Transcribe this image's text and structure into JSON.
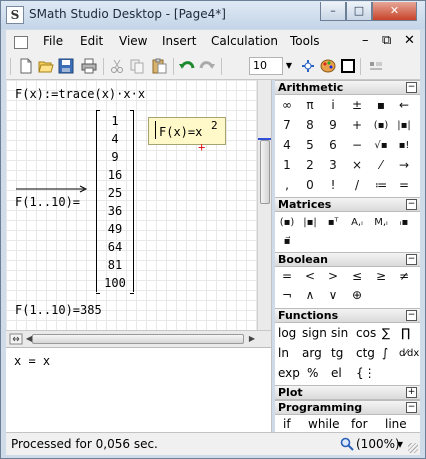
{
  "window": {
    "title": "SMath Studio Desktop - [Page4*]",
    "app_icon_letter": "S",
    "buttons": {
      "minimize": "–",
      "maximize": "□",
      "close": "✕"
    }
  },
  "menubar": {
    "items": [
      "File",
      "Edit",
      "View",
      "Insert",
      "Calculation",
      "Tools"
    ],
    "mdi": {
      "minimize": "–",
      "restore": "⧉",
      "close": "✕"
    }
  },
  "toolbar": {
    "icons": [
      "new-document-icon",
      "open-folder-icon",
      "save-icon",
      "print-icon",
      "cut-icon",
      "copy-icon",
      "paste-icon",
      "undo-icon",
      "redo-icon",
      "zoom-combo",
      "arrow-down-icon",
      "function-icon",
      "palette-icon",
      "square-icon",
      "grid-icon"
    ],
    "zoom_value": "10",
    "zoom_arrow": "▼"
  },
  "worksheet": {
    "line1": "F(x):=trace(x)·x·x",
    "range_expr": "F(1..10)=",
    "matrix_values": [
      "1",
      "4",
      "9",
      "16",
      "25",
      "36",
      "49",
      "64",
      "81",
      "100"
    ],
    "sum_expr": "F(1..10)=385",
    "tooltip": "F(x)=x",
    "tooltip_sup": "2",
    "red_marker": "+"
  },
  "hscroll": {
    "left_arrow": "◀",
    "right_arrow": "▶"
  },
  "console": {
    "text": "x = x"
  },
  "panel": {
    "arithmetic": {
      "title": "Arithmetic",
      "toggle": "⊟",
      "rows": [
        [
          "∞",
          "π",
          "i",
          "±",
          "▪",
          "←"
        ],
        [
          "7",
          "8",
          "9",
          "+",
          "(▪)",
          "|▪|"
        ],
        [
          "4",
          "5",
          "6",
          "−",
          "√▪",
          "▪!"
        ],
        [
          "1",
          "2",
          "3",
          "×",
          "⁄",
          "→"
        ],
        [
          ",",
          "0",
          "!",
          "/",
          "≔",
          "="
        ]
      ]
    },
    "matrices": {
      "title": "Matrices",
      "toggle": "⊟",
      "buttons": [
        "(▪)",
        "|▪|",
        "▪ᵀ",
        "A,ᵢ",
        "M,ᵢ",
        "ᵢ▪",
        "▪⃗"
      ]
    },
    "boolean": {
      "title": "Boolean",
      "toggle": "⊟",
      "rows": [
        [
          "=",
          "<",
          ">",
          "≤",
          "≥",
          "≠"
        ],
        [
          "¬",
          "∧",
          "∨",
          "⊕"
        ]
      ]
    },
    "functions": {
      "title": "Functions",
      "toggle": "⊟",
      "rows": [
        [
          "log",
          "sign",
          "sin",
          "cos",
          "∑",
          "∏"
        ],
        [
          "ln",
          "arg",
          "tg",
          "ctg",
          "∫",
          "d⁄dx"
        ],
        [
          "exp",
          "%",
          "el",
          "{⋮"
        ]
      ]
    },
    "plot": {
      "title": "Plot",
      "toggle": "⊞"
    },
    "programming": {
      "title": "Programming",
      "toggle": "⊟",
      "items": [
        "if",
        "while",
        "for",
        "line"
      ]
    }
  },
  "statusbar": {
    "text": "Processed for 0,056 sec.",
    "zoom": "(100%)",
    "zoom_arrow": "▾"
  }
}
